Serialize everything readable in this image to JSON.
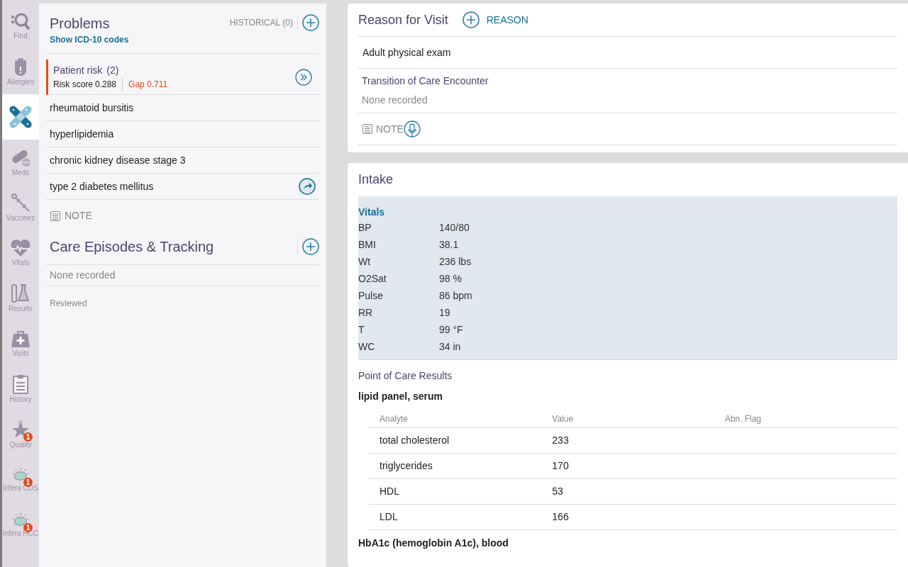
{
  "sidebar": {
    "items": [
      {
        "kind": "find",
        "label": "Find",
        "selected": false
      },
      {
        "kind": "allergies",
        "label": "Allergies",
        "selected": false
      },
      {
        "kind": "problems",
        "selected": true
      },
      {
        "kind": "meds",
        "label": "Meds",
        "selected": false
      },
      {
        "kind": "vaccines",
        "label": "Vaccines",
        "selected": false
      },
      {
        "kind": "vitals",
        "label": "Vitals",
        "selected": false
      },
      {
        "kind": "results",
        "label": "Results",
        "selected": false
      },
      {
        "kind": "visits",
        "label": "Visits",
        "selected": false
      },
      {
        "kind": "history",
        "label": "History",
        "selected": false
      },
      {
        "kind": "quality",
        "label": "Quality",
        "selected": false,
        "badge": "1"
      },
      {
        "kind": "brain",
        "label": "Infera CDS",
        "selected": false,
        "badge": "1"
      },
      {
        "kind": "brain",
        "label": "Infera HCC",
        "selected": false,
        "badge": "1"
      }
    ]
  },
  "problems": {
    "title": "Problems",
    "link": "Show ICD-10 codes",
    "historical": "HISTORICAL (0)",
    "risk": {
      "title": "Patient risk",
      "count": "(2)",
      "score_label": "Risk score",
      "score": "0.288",
      "gap": "Gap 0.711"
    },
    "items": [
      {
        "text": "rheumatoid bursitis"
      },
      {
        "text": "hyperlipidemia"
      },
      {
        "text": "chronic kidney disease stage 3"
      },
      {
        "text": "type 2 diabetes mellitus",
        "action": true
      }
    ],
    "note": "NOTE"
  },
  "care_episodes": {
    "title": "Care Episodes & Tracking",
    "empty": "None recorded",
    "reviewed": "Reviewed"
  },
  "reason_for_visit": {
    "title": "Reason for Visit",
    "add": "REASON",
    "reason": "Adult physical exam",
    "transition_title": "Transition of Care Encounter",
    "transition_value": "None recorded",
    "note": "NOTE"
  },
  "intake": {
    "title": "Intake",
    "vitals_title": "Vitals",
    "vitals": [
      {
        "name": "BP",
        "value": "140/80"
      },
      {
        "name": "BMI",
        "value": "38.1"
      },
      {
        "name": "Wt",
        "value": "236 lbs"
      },
      {
        "name": "O2Sat",
        "value": "98 %"
      },
      {
        "name": "Pulse",
        "value": "86 bpm"
      },
      {
        "name": "RR",
        "value": "19"
      },
      {
        "name": "T",
        "value": "99 °F"
      },
      {
        "name": "WC",
        "value": "34 in"
      }
    ],
    "poc_title": "Point of Care Results",
    "panels": [
      {
        "title": "lipid panel, serum",
        "columns": [
          "Analyte",
          "Value",
          "Abn. Flag"
        ],
        "rows": [
          [
            "total cholesterol",
            "233",
            ""
          ],
          [
            "triglycerides",
            "170",
            ""
          ],
          [
            "HDL",
            "53",
            ""
          ],
          [
            "LDL",
            "166",
            ""
          ]
        ]
      },
      {
        "title": "HbA1c (hemoglobin A1c), blood"
      }
    ]
  }
}
